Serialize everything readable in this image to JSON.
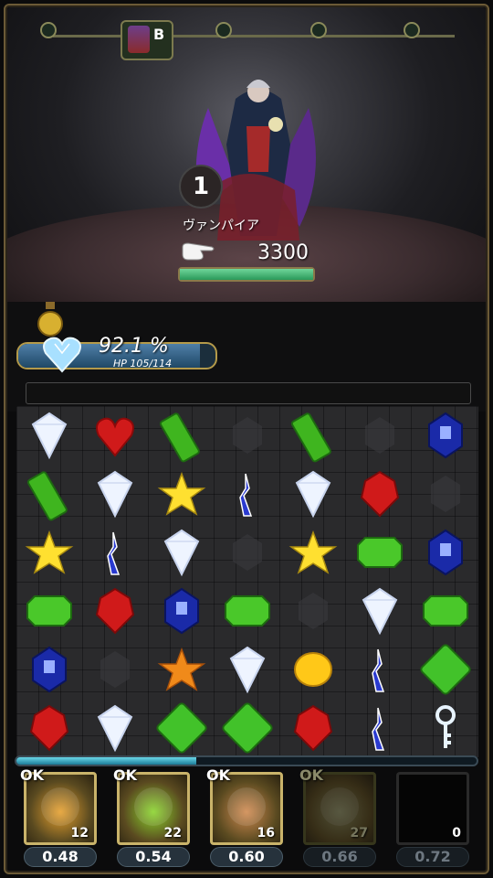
{
  "stage": {
    "boss_label": "B",
    "progress_nodes": 5
  },
  "enemy": {
    "name": "ヴァンパイア",
    "turn": "1",
    "hp": "3300",
    "hp_fraction": 1.0
  },
  "player": {
    "hp_percent": "92.1 %",
    "hp_text": "HP 105/114",
    "hp_fraction": 0.921
  },
  "skill_gauge_fraction": 0.39,
  "skills": [
    {
      "ok": "OK",
      "count": "12",
      "cost": "0.48",
      "icon": "fire-skill-icon",
      "color": "#e6a02e",
      "available": true
    },
    {
      "ok": "OK",
      "count": "22",
      "cost": "0.54",
      "icon": "poison-skill-icon",
      "color": "#8ad42c",
      "available": true
    },
    {
      "ok": "OK",
      "count": "16",
      "cost": "0.60",
      "icon": "claw-skill-icon",
      "color": "#d08a50",
      "available": true
    },
    {
      "ok": "OK",
      "count": "27",
      "cost": "0.66",
      "icon": "rock-skill-icon",
      "color": "#8a8a5a",
      "available": false
    },
    {
      "ok": "",
      "count": "0",
      "cost": "0.72",
      "icon": "empty-skill-slot",
      "color": "#111111",
      "available": false
    }
  ],
  "board": [
    [
      "diamond",
      "heart",
      "green-rect",
      "gray",
      "green-rect",
      "gray",
      "blue-sapphire"
    ],
    [
      "green-rect",
      "diamond",
      "star",
      "blue-shard",
      "diamond",
      "red-ruby",
      "gray"
    ],
    [
      "star",
      "blue-shard",
      "diamond",
      "gray",
      "star",
      "green-emerald",
      "blue-sapphire"
    ],
    [
      "green-emerald",
      "red-ruby",
      "blue-sapphire",
      "green-emerald",
      "gray",
      "diamond",
      "green-emerald"
    ],
    [
      "blue-sapphire",
      "gray",
      "orange-star",
      "diamond",
      "yellow-coin",
      "blue-shard",
      "green-square"
    ],
    [
      "red-ruby",
      "diamond",
      "green-square",
      "green-square",
      "red-ruby",
      "blue-shard",
      "key"
    ]
  ],
  "colors": {
    "gold": "#c9b36a",
    "hp_blue": "#2a5a7e",
    "enemy_green": "#4ac07a"
  }
}
